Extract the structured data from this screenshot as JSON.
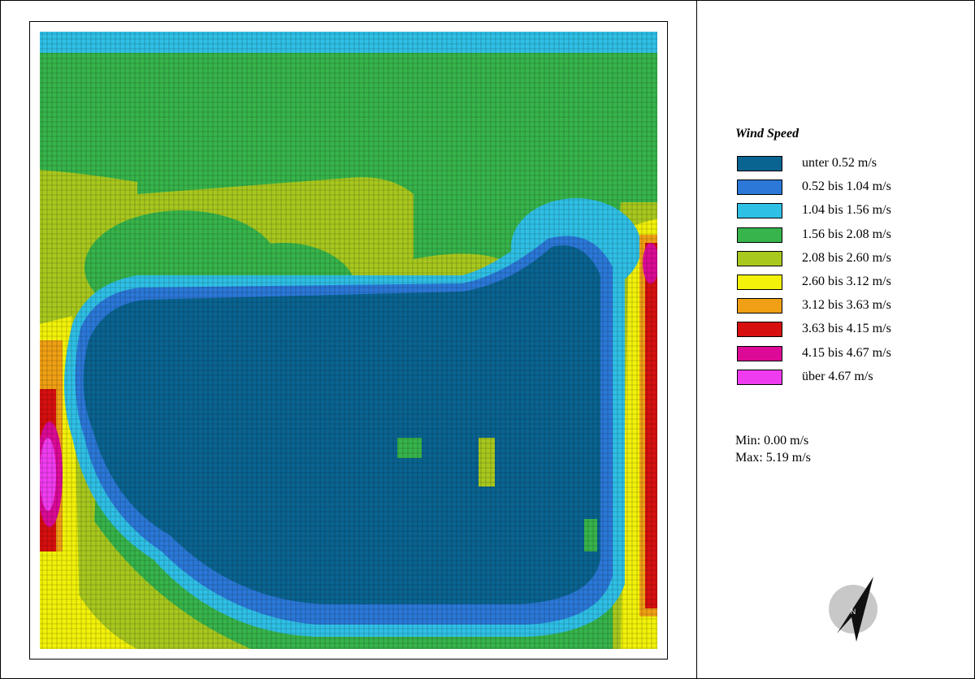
{
  "legend": {
    "title": "Wind Speed",
    "items": [
      {
        "label": "unter 0.52 m/s",
        "color": "#0a6491"
      },
      {
        "label": "0.52 bis 1.04 m/s",
        "color": "#2b78d8"
      },
      {
        "label": "1.04 bis 1.56 m/s",
        "color": "#2fc0e6"
      },
      {
        "label": "1.56 bis 2.08 m/s",
        "color": "#37b44b"
      },
      {
        "label": "2.08 bis 2.60 m/s",
        "color": "#a8c81e"
      },
      {
        "label": "2.60 bis 3.12 m/s",
        "color": "#f2f20a"
      },
      {
        "label": "3.12 bis 3.63 m/s",
        "color": "#f0a014"
      },
      {
        "label": "3.63 bis 4.15 m/s",
        "color": "#d70f0f"
      },
      {
        "label": "4.15 bis 4.67 m/s",
        "color": "#dc0a96"
      },
      {
        "label": "über 4.67 m/s",
        "color": "#f03cf0"
      }
    ]
  },
  "stats": {
    "min": "Min: 0.00 m/s",
    "max": "Max: 5.19 m/s"
  },
  "compass": {
    "letter": "N",
    "icon": "north-arrow-icon"
  }
}
